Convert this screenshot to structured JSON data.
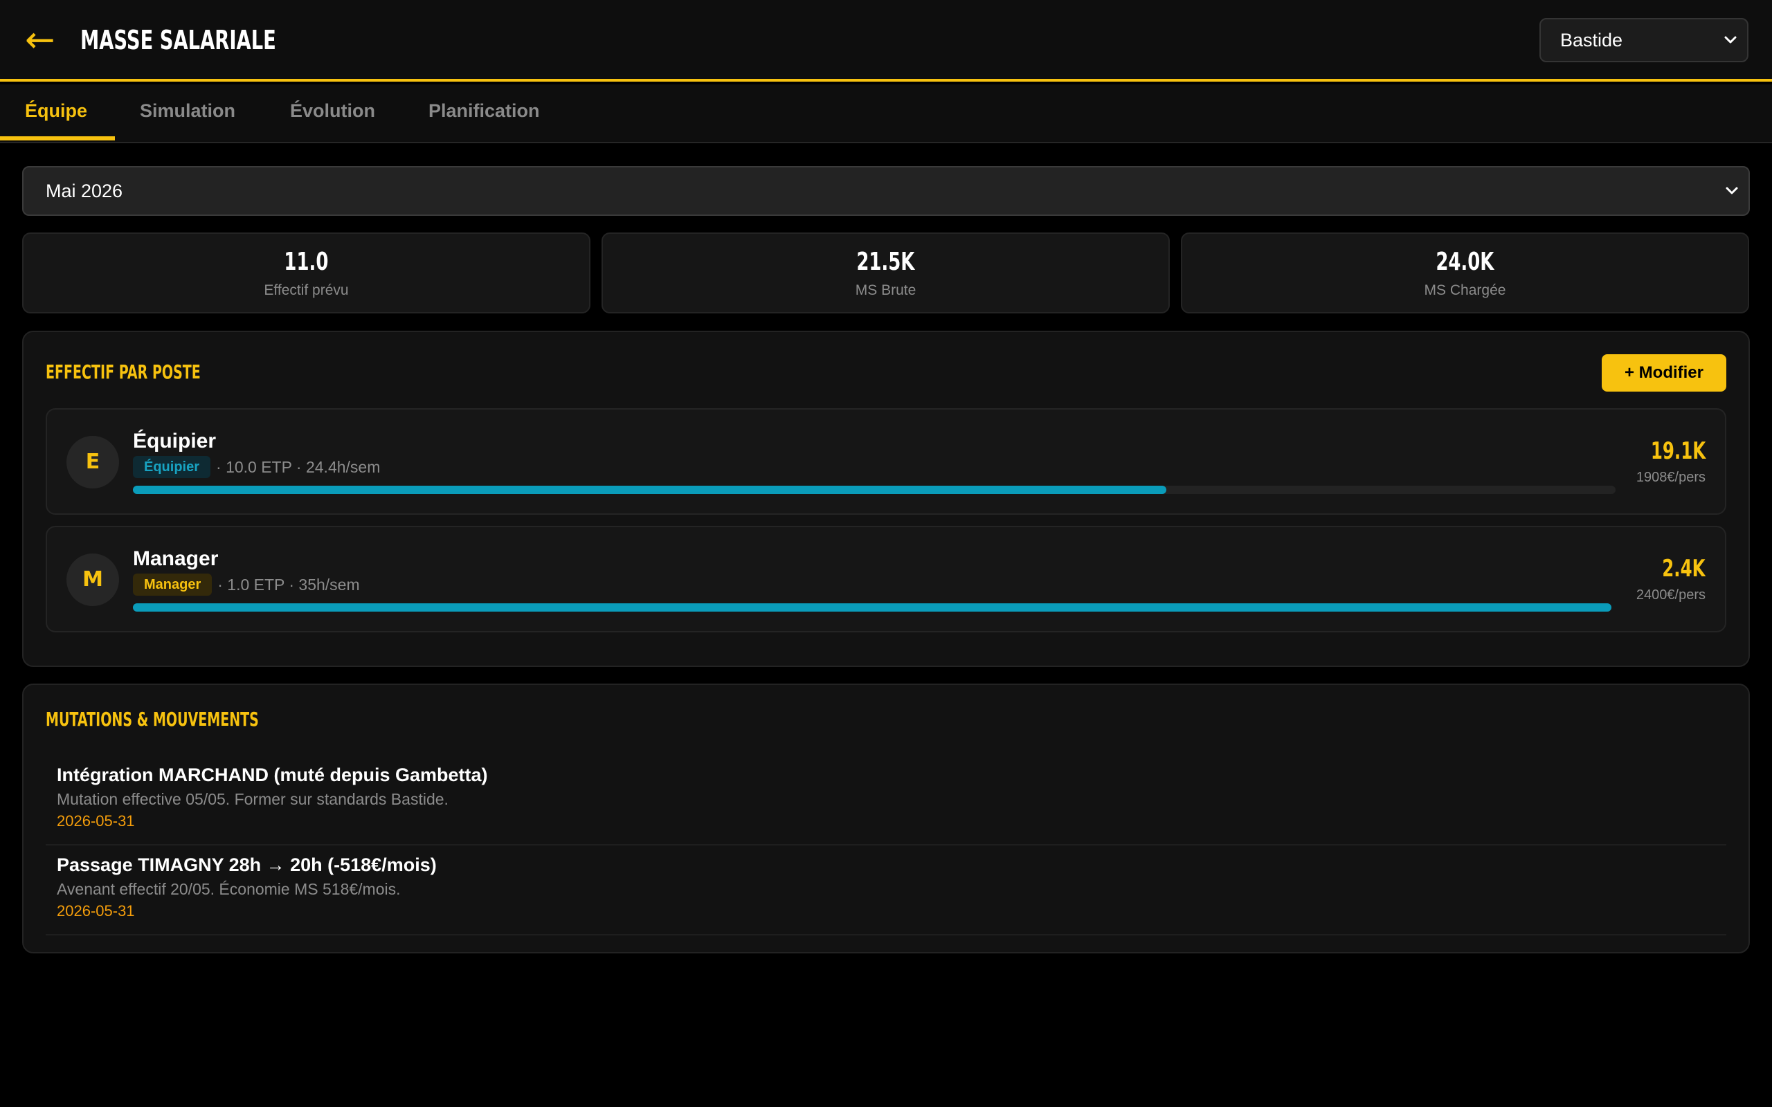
{
  "header": {
    "back_icon": "arrow-left-icon",
    "title": "MASSE SALARIALE",
    "store": "Bastide",
    "accent_color": "#f7c20f"
  },
  "tabs": [
    {
      "label": "Équipe",
      "active": true
    },
    {
      "label": "Simulation",
      "active": false
    },
    {
      "label": "Évolution",
      "active": false
    },
    {
      "label": "Planification",
      "active": false
    }
  ],
  "month_select": {
    "value": "Mai 2026"
  },
  "kpis": [
    {
      "value": "11.0",
      "label": "Effectif prévu"
    },
    {
      "value": "21.5K",
      "label": "MS Brute"
    },
    {
      "value": "24.0K",
      "label": "MS Chargée"
    }
  ],
  "effectif": {
    "title": "EFFECTIF PAR POSTE",
    "modify_label": "+ Modifier",
    "posts": [
      {
        "initial": "E",
        "name": "Équipier",
        "badge": "Équipier",
        "details": "· 10.0 ETP · 24.4h/sem",
        "amount": "19.1K",
        "per": "1908€/pers",
        "share": 0.697,
        "bar_color": "#0a9cba"
      },
      {
        "initial": "M",
        "name": "Manager",
        "badge": "Manager",
        "details": "· 1.0 ETP · 35h/sem",
        "amount": "2.4K",
        "per": "2400€/pers",
        "share": 1.0,
        "bar_color": "#0a9cba"
      }
    ]
  },
  "mutations": {
    "title": "MUTATIONS & MOUVEMENTS",
    "items": [
      {
        "title": "Intégration MARCHAND (muté depuis Gambetta)",
        "description": "Mutation effective 05/05. Former sur standards Bastide.",
        "date": "2026-05-31"
      },
      {
        "title": "Passage TIMAGNY 28h → 20h (-518€/mois)",
        "description": "Avenant effectif 20/05. Économie MS 518€/mois.",
        "date": "2026-05-31"
      }
    ]
  }
}
